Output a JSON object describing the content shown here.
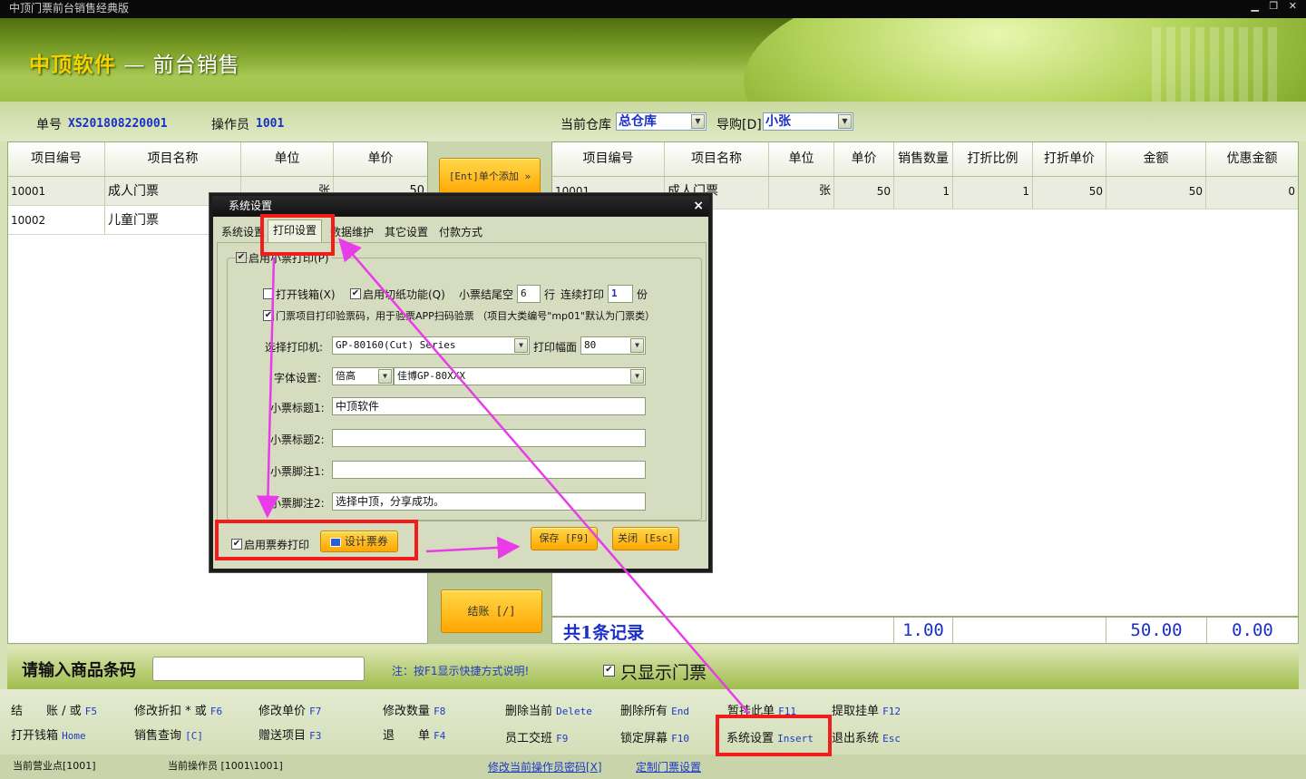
{
  "window": {
    "title": "中顶门票前台销售经典版",
    "controls": "▁ ❐ ✕"
  },
  "brand": {
    "company": "中顶软件",
    "dash": "—",
    "module": "前台销售"
  },
  "info": {
    "order_label": "单号",
    "order_no": "XS201808220001",
    "operator_label": "操作员",
    "operator": "1001",
    "warehouse_label": "当前仓库",
    "warehouse": "总仓库",
    "guide_label": "导购[D]",
    "guide": "小张"
  },
  "left_grid": {
    "headers": [
      "项目编号",
      "项目名称",
      "单位",
      "单价"
    ],
    "rows": [
      {
        "code": "10001",
        "name": "成人门票",
        "unit": "张",
        "price": "50"
      },
      {
        "code": "10002",
        "name": "儿童门票",
        "unit": "",
        "price": ""
      }
    ]
  },
  "mid": {
    "add_button": "[Ent]单个添加 »",
    "checkout_button": "结账 [/]"
  },
  "right_grid": {
    "headers": [
      "项目编号",
      "项目名称",
      "单位",
      "单价",
      "销售数量",
      "打折比例",
      "打折单价",
      "金额",
      "优惠金额"
    ],
    "rows": [
      {
        "code": "10001",
        "name": "成人门票",
        "unit": "张",
        "price": "50",
        "qty": "1",
        "ratio": "1",
        "dprice": "50",
        "amount": "50",
        "discount": "0"
      }
    ]
  },
  "totals": {
    "records": "共1条记录",
    "qty": "1.00",
    "amount": "50.00",
    "discount": "0.00"
  },
  "barcode": {
    "label": "请输入商品条码",
    "value": "",
    "hint": "注：按F1显示快捷方式说明!",
    "only_tickets_label": "只显示门票",
    "only_tickets_checked": true
  },
  "shortcuts": {
    "checkout": {
      "label": "结　　账 / 或",
      "key": "F5"
    },
    "discount": {
      "label": "修改折扣 * 或",
      "key": "F6"
    },
    "price": {
      "label": "修改单价",
      "key": "F7"
    },
    "qty": {
      "label": "修改数量",
      "key": "F8"
    },
    "delete_cur": {
      "label": "删除当前",
      "key": "Delete"
    },
    "delete_all": {
      "label": "删除所有",
      "key": "End"
    },
    "hold": {
      "label": "暂挂此单",
      "key": "F11"
    },
    "fetch": {
      "label": "提取挂单",
      "key": "F12"
    },
    "drawer": {
      "label": "打开钱箱",
      "key": "Home"
    },
    "query": {
      "label": "销售查询",
      "key": "[C]"
    },
    "gift": {
      "label": "赠送项目",
      "key": "F3"
    },
    "refund": {
      "label": "退　　单",
      "key": "F4"
    },
    "shift": {
      "label": "员工交班",
      "key": "F9"
    },
    "lock": {
      "label": "锁定屏幕",
      "key": "F10"
    },
    "settings": {
      "label": "系统设置",
      "key": "Insert"
    },
    "exit": {
      "label": "退出系统",
      "key": "Esc"
    }
  },
  "status": {
    "store": "当前营业点[1001]",
    "operator": "当前操作员 [1001\\1001]",
    "change_pwd": "修改当前操作员密码[X]",
    "custom_settings": "定制门票设置"
  },
  "dialog": {
    "title": "系统设置",
    "close": "×",
    "tabs": [
      "系统设置",
      "打印设置",
      "数据维护",
      "其它设置",
      "付款方式"
    ],
    "active_tab": "打印设置",
    "enable_receipt": "启用小票打印(P)",
    "open_drawer": "打开钱箱(X)",
    "cut_paper": "启用切纸功能(Q)",
    "tail_blank_label": "小票结尾空",
    "tail_blank": "6",
    "rows_unit": "行",
    "copies_label": "连续打印",
    "copies": "1",
    "copies_unit": "份",
    "qr_verify": "门票项目打印验票码，用于验票APP扫码验票 （项目大类编号\"mp01\"默认为门票类）",
    "printer_label": "选择打印机:",
    "printer": "GP-80160(Cut) Series",
    "width_label": "打印幅面",
    "width": "80",
    "font_label": "字体设置:",
    "font_size": "倍高",
    "font_name": "佳博GP-80XXX",
    "title1_label": "小票标题1:",
    "title1": "中顶软件",
    "title2_label": "小票标题2:",
    "title2": "",
    "foot1_label": "小票脚注1:",
    "foot1": "",
    "foot2_label": "小票脚注2:",
    "foot2": "选择中顶，分享成功。",
    "enable_ticket_print": "启用票券打印",
    "design_ticket": "设计票券",
    "save": "保存 [F9]",
    "cancel": "关闭 [Esc]"
  },
  "colors": {
    "accent_blue": "#1a2fc7",
    "highlight_red": "#f21c1c",
    "arrow_magenta": "#e83ce8",
    "button_orange": "#ffa600"
  }
}
